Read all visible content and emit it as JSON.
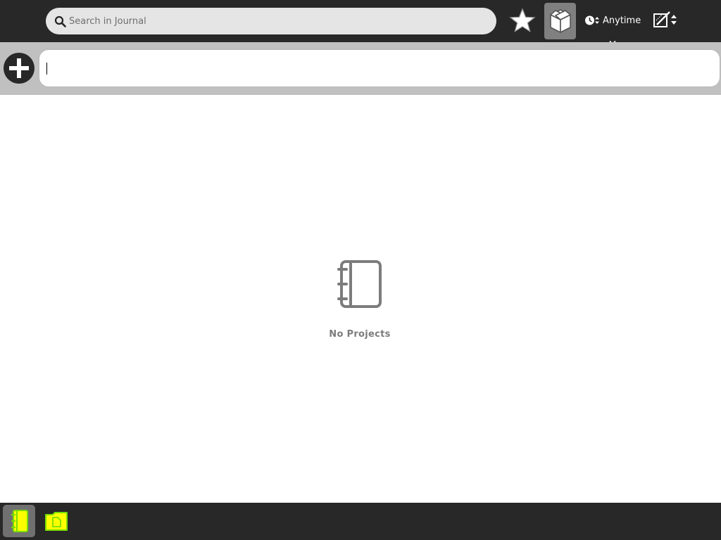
{
  "toolbar": {
    "search": {
      "placeholder": "Search in Journal",
      "value": "",
      "icon": "search-icon"
    },
    "favorite_icon": "star-icon",
    "projects_icon": "projects-box-icon",
    "time_filter": {
      "label": "Anytime",
      "icon": "clock-icon"
    },
    "edit_icon": "edit-sort-icon"
  },
  "entry": {
    "add_icon": "plus-icon",
    "title_value": ""
  },
  "main": {
    "empty_icon": "notebook-icon",
    "empty_text": "No Projects"
  },
  "taskbar": {
    "items": [
      {
        "icon": "journal-icon",
        "active": true
      },
      {
        "icon": "documents-folder-icon",
        "active": false
      }
    ]
  },
  "colors": {
    "toolbar_bg": "#282828",
    "entry_bg": "#c0c0c0",
    "accent": "#ffff00",
    "accent_fill": "#77dd00",
    "muted": "#7c7c7c"
  }
}
